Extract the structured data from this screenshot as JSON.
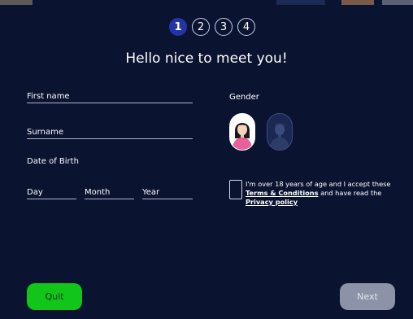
{
  "steps": [
    "1",
    "2",
    "3",
    "4"
  ],
  "active_step": "1",
  "title": "Hello nice to meet you!",
  "form": {
    "first_name_placeholder": "First name",
    "surname_placeholder": "Surname",
    "dob_label": "Date of Birth",
    "day_placeholder": "Day",
    "month_placeholder": "Month",
    "year_placeholder": "Year",
    "gender_label": "Gender"
  },
  "terms": {
    "prefix": "I'm over 18 years of age and I accept these ",
    "terms_link": "Terms & Conditions",
    "middle": " and have read the ",
    "privacy_link": "Privacy policy"
  },
  "buttons": {
    "quit": "Quit",
    "next": "Next"
  },
  "colors": {
    "background": "#0a1330",
    "active_step": "#2434a5",
    "quit_button": "#12c519",
    "next_button_disabled": "#8c93a6"
  },
  "icons": {
    "female_avatar": "female-avatar-icon",
    "male_avatar": "male-avatar-icon"
  }
}
